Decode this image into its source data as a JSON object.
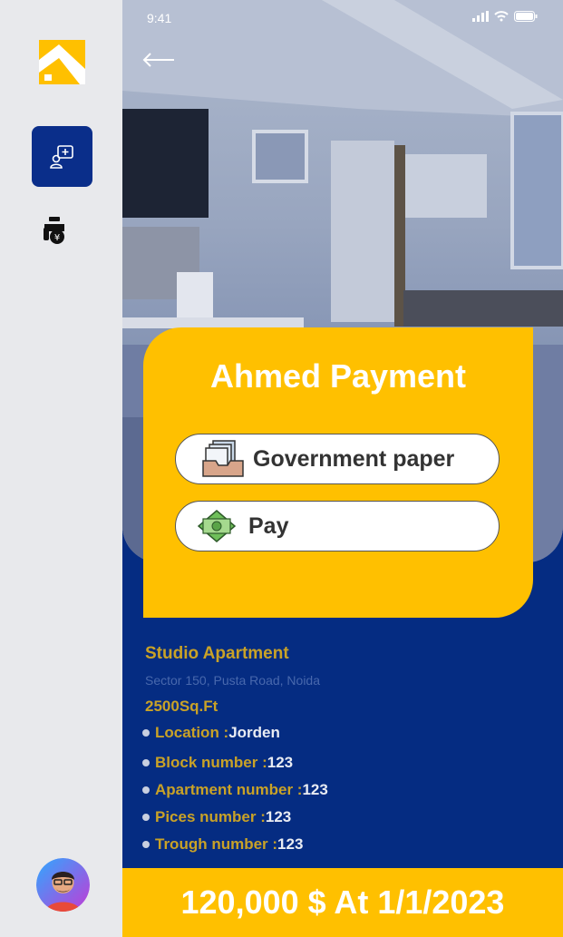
{
  "status_bar": {
    "time": "9:41"
  },
  "card": {
    "title": "Ahmed Payment",
    "buttons": [
      {
        "label": "Government paper",
        "icon": "document-tray-icon"
      },
      {
        "label": "Pay",
        "icon": "money-icon"
      }
    ]
  },
  "property": {
    "title": "Studio Apartment",
    "address": "Sector 150, Pusta Road, Noida",
    "area": "2500Sq.Ft",
    "details": [
      {
        "label": "Location : ",
        "value": "Jorden"
      },
      {
        "label": "Block number : ",
        "value": "123"
      },
      {
        "label": "Apartment number : ",
        "value": "123"
      },
      {
        "label": "Pices number : ",
        "value": "123"
      },
      {
        "label": "Trough number : ",
        "value": "123"
      }
    ]
  },
  "footer": {
    "price_text": "120,000 $ At 1/1/2023"
  },
  "colors": {
    "brand_yellow": "#ffc000",
    "navy": "#052c82",
    "sidebar": "#e8e9ec"
  }
}
